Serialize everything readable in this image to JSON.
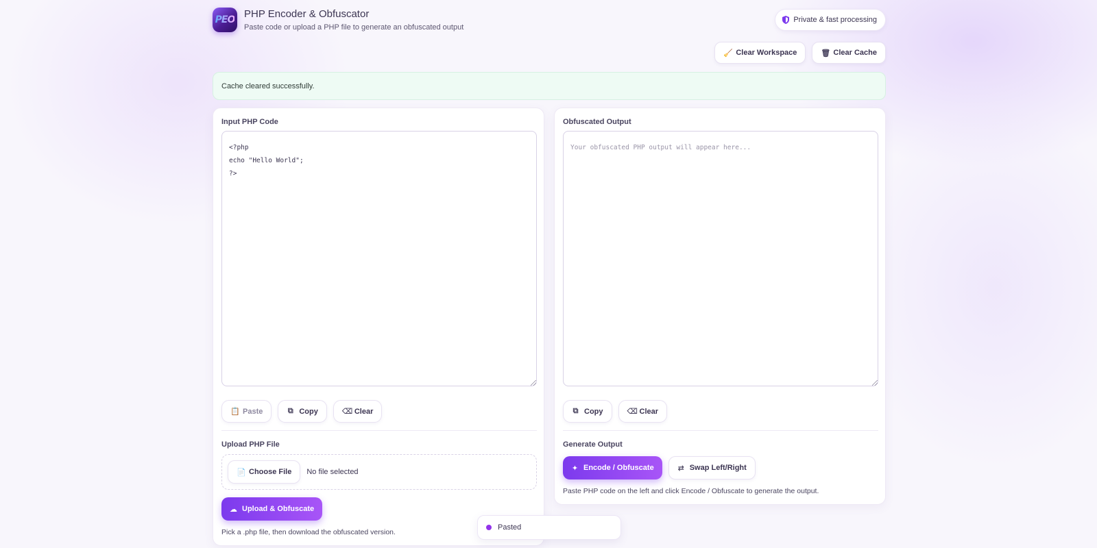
{
  "header": {
    "logo_text": "PEO",
    "title": "PHP Encoder & Obfuscator",
    "subtitle": "Paste code or upload a PHP file to generate an obfuscated output",
    "privacy_label": "Private & fast processing"
  },
  "top_actions": {
    "clear_workspace": "Clear Workspace",
    "clear_cache": "Clear Cache"
  },
  "alert": {
    "message": "Cache cleared successfully."
  },
  "input_panel": {
    "label": "Input PHP Code",
    "code": "<?php\necho \"Hello World\";\n?>",
    "paste_label": "Paste",
    "copy_label": "Copy",
    "clear_label": "Clear",
    "upload_label": "Upload PHP File",
    "choose_file_label": "Choose File",
    "no_file_text": "No file selected",
    "upload_button": "Upload & Obfuscate",
    "hint": "Pick a .php file, then download the obfuscated version."
  },
  "output_panel": {
    "label": "Obfuscated Output",
    "placeholder": "Your obfuscated PHP output will appear here...",
    "copy_label": "Copy",
    "clear_label": "Clear",
    "generate_label": "Generate Output",
    "encode_button": "Encode / Obfuscate",
    "swap_button": "Swap Left/Right",
    "hint": "Paste PHP code on the left and click Encode / Obfuscate to generate the output."
  },
  "toast": {
    "message": "Pasted",
    "dot_color": "#9333ea"
  },
  "colors": {
    "accent": "#7c3aed",
    "success_bg": "#eefbf4"
  }
}
